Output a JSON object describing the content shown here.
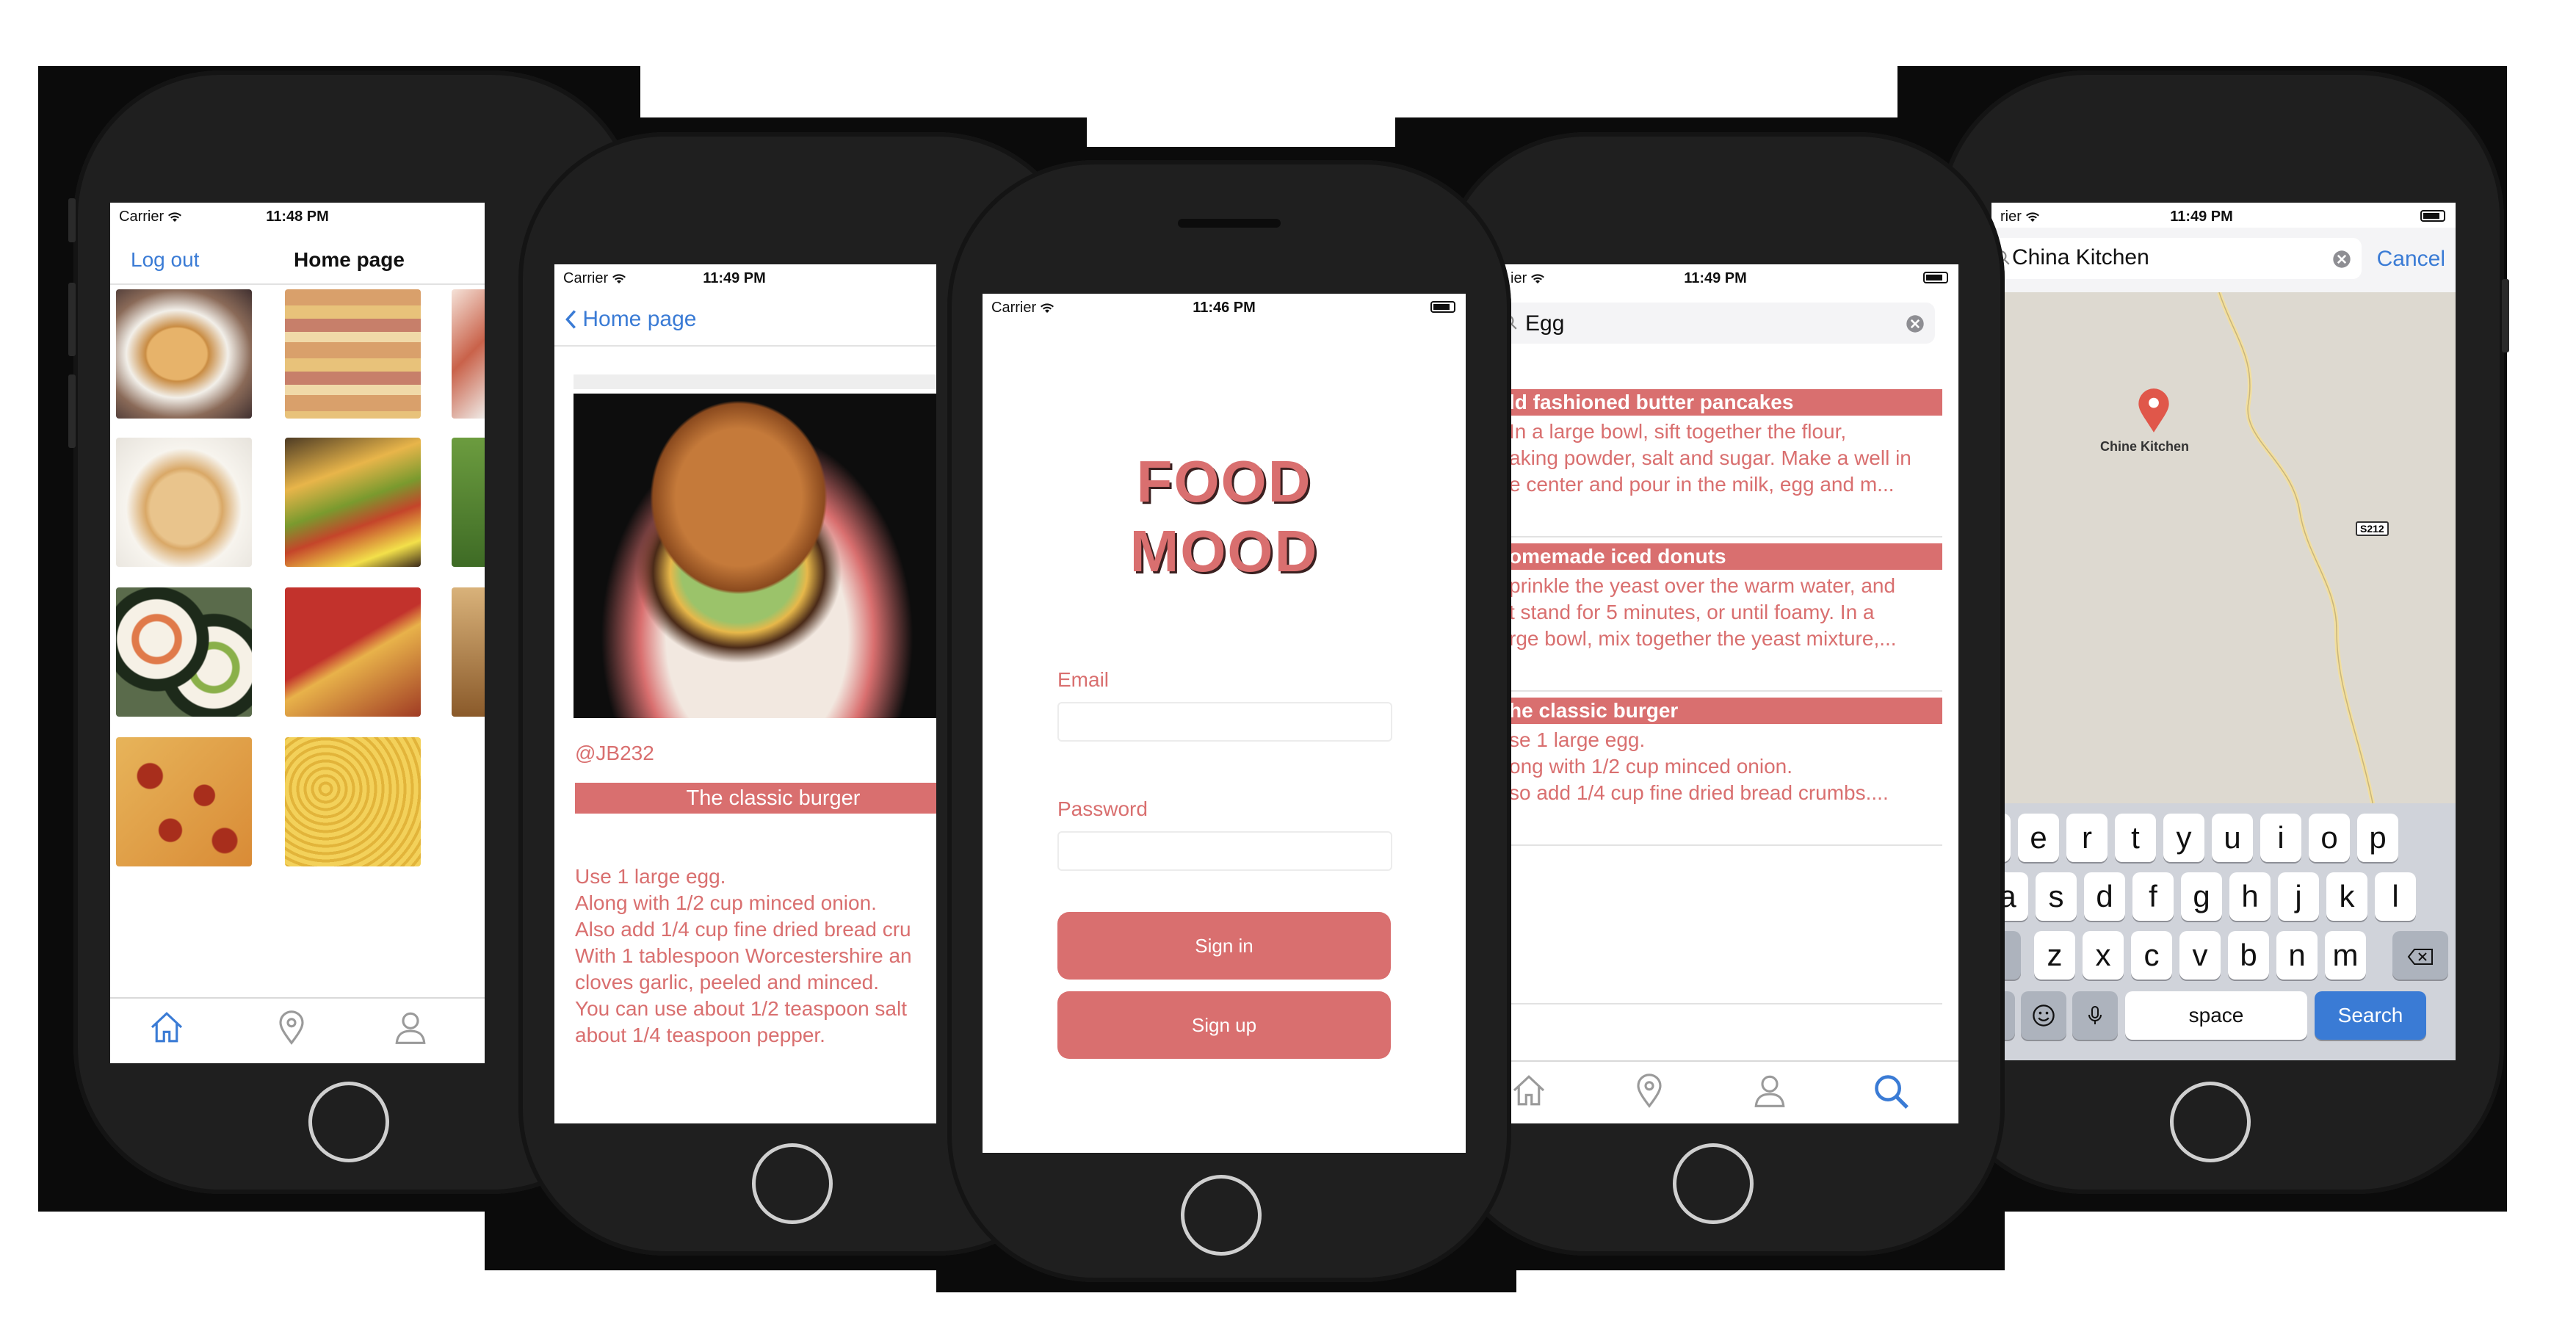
{
  "colors": {
    "accent": "#d96f6f",
    "link": "#3a7bd5",
    "dark": "#1f1f1f"
  },
  "status": {
    "carrier": "Carrier",
    "times": [
      "11:48 PM",
      "11:49 PM",
      "11:46 PM",
      "11:49 PM",
      "11:49 PM"
    ]
  },
  "home": {
    "left_btn": "Log out",
    "title": "Home page"
  },
  "detail": {
    "back": "Home page",
    "user": "@JB232",
    "title": "The classic burger",
    "body": "Use 1 large egg.\nAlong with 1/2 cup minced onion.\nAlso add 1/4 cup fine dried bread cru\nWith 1 tablespoon Worcestershire an\ncloves garlic, peeled and minced.\nYou can use about 1/2 teaspoon salt\nabout 1/4 teaspoon pepper."
  },
  "login": {
    "title1": "FOOD",
    "title2": "MOOD",
    "email_label": "Email",
    "password_label": "Password",
    "signin": "Sign in",
    "signup": "Sign up"
  },
  "search": {
    "carrier": "ier",
    "query": "Egg",
    "results": [
      {
        "title": "ld fashioned butter pancakes",
        "text": "In a large bowl, sift together the flour,\naking powder, salt and sugar. Make a well in\ne center and pour in the milk, egg and m..."
      },
      {
        "title": "omemade iced donuts",
        "text": "prinkle the yeast over the warm water, and\nt stand for 5 minutes, or until foamy. In a\nrge bowl, mix together the yeast mixture,..."
      },
      {
        "title": "he classic burger",
        "text": "se 1 large egg.\nong with 1/2 cup minced onion.\nso add 1/4 cup fine dried bread crumbs...."
      }
    ]
  },
  "map": {
    "carrier": "rier",
    "query": "China Kitchen",
    "cancel": "Cancel",
    "pin_label": "Chine Kitchen",
    "road": "S212",
    "row1": [
      "w",
      "e",
      "r",
      "t",
      "y",
      "u",
      "i",
      "o",
      "p"
    ],
    "row2": [
      "a",
      "s",
      "d",
      "f",
      "g",
      "h",
      "j",
      "k",
      "l"
    ],
    "row3": [
      "z",
      "x",
      "c",
      "v",
      "b",
      "n",
      "m"
    ],
    "numkey": "23",
    "space": "space",
    "search": "Search"
  }
}
